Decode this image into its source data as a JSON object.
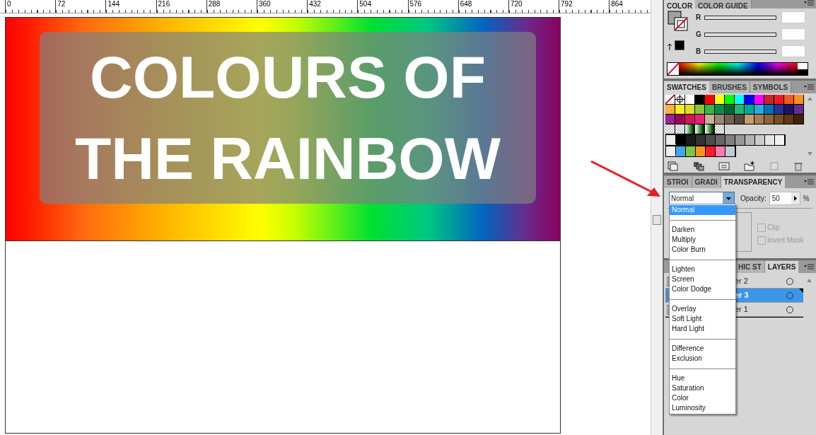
{
  "ruler": {
    "labels": [
      "0",
      "72",
      "144",
      "216",
      "288",
      "360",
      "432",
      "504",
      "576",
      "648",
      "720",
      "792",
      "864"
    ]
  },
  "artboard": {
    "title_lines": [
      "COLOURS OF",
      "THE RAINBOW"
    ]
  },
  "color_panel": {
    "tabs": [
      {
        "label": "COLOR",
        "selected": true
      },
      {
        "label": "COLOR GUIDE",
        "selected": false
      }
    ],
    "channels": [
      {
        "label": "R",
        "level": 0
      },
      {
        "label": "G",
        "level": 0
      },
      {
        "label": "B",
        "level": 0
      }
    ]
  },
  "swatches_panel": {
    "tabs": [
      {
        "label": "SWATCHES",
        "selected": true
      },
      {
        "label": "BRUSHES",
        "selected": false
      },
      {
        "label": "SYMBOLS",
        "selected": false
      }
    ],
    "rows": [
      [
        {
          "kind": "none"
        },
        {
          "kind": "register"
        },
        {
          "kind": "color",
          "color": "#ffffff"
        },
        {
          "kind": "color",
          "color": "#000000"
        },
        {
          "kind": "color",
          "color": "#ff0000"
        },
        {
          "kind": "color",
          "color": "#ffff00"
        },
        {
          "kind": "color",
          "color": "#00ff00"
        },
        {
          "kind": "color",
          "color": "#00ffff"
        },
        {
          "kind": "color",
          "color": "#0000ff"
        },
        {
          "kind": "color",
          "color": "#ff00ff"
        },
        {
          "kind": "color",
          "color": "#c1272d"
        },
        {
          "kind": "color",
          "color": "#ed1c24"
        },
        {
          "kind": "color",
          "color": "#f15a24"
        },
        {
          "kind": "color",
          "color": "#f7931e"
        }
      ],
      [
        {
          "kind": "color",
          "color": "#fbb03b"
        },
        {
          "kind": "color",
          "color": "#fcee21"
        },
        {
          "kind": "color",
          "color": "#d9e021"
        },
        {
          "kind": "color",
          "color": "#8cc63f"
        },
        {
          "kind": "color",
          "color": "#39b54a"
        },
        {
          "kind": "color",
          "color": "#009245"
        },
        {
          "kind": "color",
          "color": "#006837"
        },
        {
          "kind": "color",
          "color": "#22b573"
        },
        {
          "kind": "color",
          "color": "#00a99d"
        },
        {
          "kind": "color",
          "color": "#29abe2"
        },
        {
          "kind": "color",
          "color": "#0071bc"
        },
        {
          "kind": "color",
          "color": "#2e3192"
        },
        {
          "kind": "color",
          "color": "#1b1464"
        },
        {
          "kind": "color",
          "color": "#662d91"
        }
      ],
      [
        {
          "kind": "color",
          "color": "#93278f"
        },
        {
          "kind": "color",
          "color": "#9e005d"
        },
        {
          "kind": "color",
          "color": "#d4145a"
        },
        {
          "kind": "color",
          "color": "#ed1e79"
        },
        {
          "kind": "color",
          "color": "#c7b299"
        },
        {
          "kind": "color",
          "color": "#998675"
        },
        {
          "kind": "color",
          "color": "#736357"
        },
        {
          "kind": "color",
          "color": "#534741"
        },
        {
          "kind": "color",
          "color": "#c69c6d"
        },
        {
          "kind": "color",
          "color": "#a67c52"
        },
        {
          "kind": "color",
          "color": "#8c6239"
        },
        {
          "kind": "color",
          "color": "#754c24"
        },
        {
          "kind": "color",
          "color": "#603813"
        },
        {
          "kind": "color",
          "color": "#42210b"
        }
      ],
      [
        {
          "kind": "pattern"
        },
        {
          "kind": "pattern"
        },
        {
          "kind": "gradient"
        },
        {
          "kind": "gradient"
        },
        {
          "kind": "gradient"
        },
        {
          "kind": "pattern"
        }
      ]
    ],
    "groups": [
      [
        {
          "color": "#000000"
        },
        {
          "color": "#1a1a1a"
        },
        {
          "color": "#333333"
        },
        {
          "color": "#4d4d4d"
        },
        {
          "color": "#666666"
        },
        {
          "color": "#808080"
        },
        {
          "color": "#999999"
        },
        {
          "color": "#b3b3b3"
        },
        {
          "color": "#cccccc"
        },
        {
          "color": "#e6e6e6"
        },
        {
          "color": "#f2f2f2"
        }
      ],
      [
        {
          "color": "#42a5f5"
        },
        {
          "color": "#7ac943"
        },
        {
          "color": "#ff931e"
        },
        {
          "color": "#ff1d25"
        },
        {
          "color": "#ff7bac"
        },
        {
          "color": "#bdccd4"
        }
      ]
    ]
  },
  "transparency_panel": {
    "tabs": [
      {
        "label": "STROI",
        "selected": false
      },
      {
        "label": "GRADI",
        "selected": false
      },
      {
        "label": "TRANSPARENCY",
        "selected": true
      }
    ],
    "blend_mode": "Normal",
    "opacity_label": "Opacity:",
    "opacity": "50",
    "unit": "%",
    "clip": {
      "label": "Clip",
      "checked": false
    },
    "invert_mask": {
      "label": "Invert Mask",
      "checked": false
    }
  },
  "blend_menu": {
    "groups": [
      [
        {
          "label": "Normal",
          "selected": true
        }
      ],
      [
        {
          "label": "Darken",
          "selected": false
        },
        {
          "label": "Multiply",
          "selected": false
        },
        {
          "label": "Color Burn",
          "selected": false
        }
      ],
      [
        {
          "label": "Lighten",
          "selected": false
        },
        {
          "label": "Screen",
          "selected": false
        },
        {
          "label": "Color Dodge",
          "selected": false
        }
      ],
      [
        {
          "label": "Overlay",
          "selected": false
        },
        {
          "label": "Soft Light",
          "selected": false
        },
        {
          "label": "Hard Light",
          "selected": false
        }
      ],
      [
        {
          "label": "Difference",
          "selected": false
        },
        {
          "label": "Exclusion",
          "selected": false
        }
      ],
      [
        {
          "label": "Hue",
          "selected": false
        },
        {
          "label": "Saturation",
          "selected": false
        },
        {
          "label": "Color",
          "selected": false
        },
        {
          "label": "Luminosity",
          "selected": false
        }
      ]
    ]
  },
  "layers_panel": {
    "tabs": [
      {
        "label": "HIC ST",
        "selected": false
      },
      {
        "label": "LAYERS",
        "selected": true
      }
    ],
    "rows": [
      {
        "name": "er 2",
        "selected": false
      },
      {
        "name": "er 3",
        "selected": true
      },
      {
        "name": "er 1",
        "selected": false
      }
    ]
  }
}
